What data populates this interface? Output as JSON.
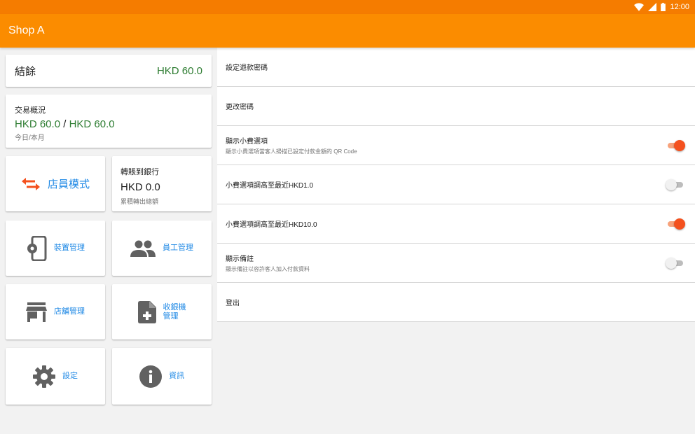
{
  "status_bar": {
    "time": "12:00"
  },
  "app_bar": {
    "title": "Shop A"
  },
  "balance": {
    "label": "結餘",
    "value": "HKD 60.0"
  },
  "overview": {
    "title": "交易概況",
    "today": "HKD 60.0",
    "separator": "/",
    "month": "HKD 60.0",
    "subtitle": "今日/本月"
  },
  "staff_mode": {
    "label": "店員模式"
  },
  "transfer": {
    "title": "轉賬到銀行",
    "value": "HKD 0.0",
    "subtitle": "累積轉出總額"
  },
  "tiles": [
    {
      "label": "裝置管理",
      "icon": "device-settings-icon"
    },
    {
      "label": "員工管理",
      "icon": "people-icon"
    },
    {
      "label": "店舖管理",
      "icon": "store-icon"
    },
    {
      "label_line1": "收銀機",
      "label_line2": "管理",
      "icon": "add-document-icon"
    },
    {
      "label": "設定",
      "icon": "gear-icon"
    },
    {
      "label": "資訊",
      "icon": "info-icon"
    }
  ],
  "settings": [
    {
      "title": "設定退款密碼"
    },
    {
      "title": "更改密碼"
    },
    {
      "title": "顯示小費選項",
      "description": "顯示小費選項當客人掃描已設定付款金額的 QR Code",
      "toggle": true
    },
    {
      "title": "小費選項調高至最近HKD1.0",
      "toggle": false
    },
    {
      "title": "小費選項調高至最近HKD10.0",
      "toggle": true
    },
    {
      "title": "顯示備註",
      "description": "顯示備註以容許客人加入付款資料",
      "toggle": false
    },
    {
      "title": "登出"
    }
  ],
  "colors": {
    "status_bar": "#f57c00",
    "app_bar": "#fb8c00",
    "money": "#2e7d32",
    "link": "#1e88e5",
    "switch_on": "#f4511e"
  }
}
